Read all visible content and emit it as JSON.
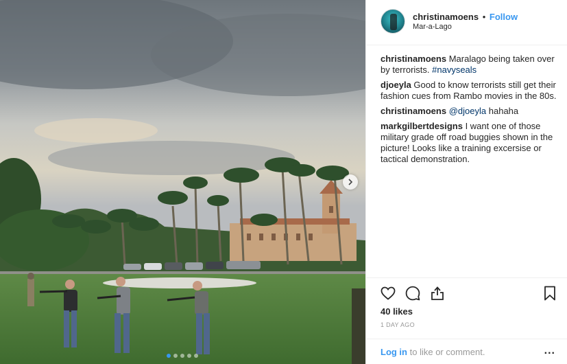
{
  "post": {
    "username": "christinamoens",
    "separator": "•",
    "follow_label": "Follow",
    "location": "Mar-a-Lago"
  },
  "comments": [
    {
      "user": "christinamoens",
      "text": "Maralago being taken over by terrorists.",
      "tag": "#navyseals"
    },
    {
      "user": "djoeyla",
      "text": "Good to know terrorists still get their fashion cues from Rambo movies in the 80s."
    },
    {
      "user": "christinamoens",
      "mention": "@djoeyla",
      "text": "hahaha"
    },
    {
      "user": "markgilbertdesigns",
      "text": "I want one of those military grade off road buggies shown in the picture! Looks like a training excersise or tactical demonstration."
    }
  ],
  "actions": {
    "like_icon": "heart-icon",
    "comment_icon": "comment-icon",
    "share_icon": "share-icon",
    "save_icon": "bookmark-icon",
    "likes": "40 likes",
    "age": "1 DAY AGO"
  },
  "footer": {
    "login_link": "Log in",
    "login_rest": "to like or comment.",
    "more": "..."
  },
  "carousel": {
    "slides": 5,
    "active": 1
  },
  "colors": {
    "accent": "#3897f0",
    "text": "#262626",
    "muted": "#999999",
    "border": "#efefef"
  }
}
